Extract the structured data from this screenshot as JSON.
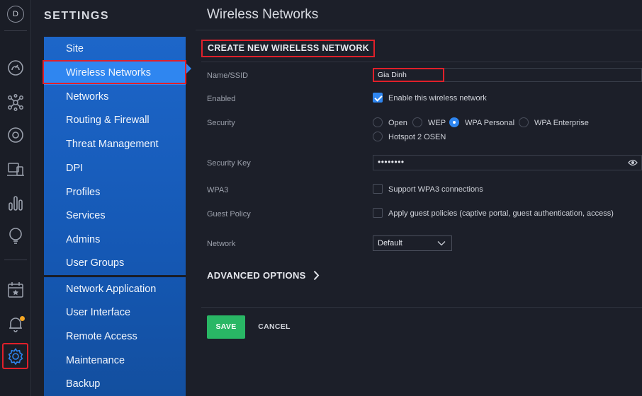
{
  "user": {
    "initial": "D"
  },
  "rail": {
    "icons": [
      "dashboard-icon",
      "topology-icon",
      "devices-icon",
      "clients-icon",
      "statistics-icon",
      "insights-icon",
      "events-icon",
      "alerts-icon",
      "settings-icon"
    ],
    "active": "settings-icon",
    "alert_dot_color": "#f5a623"
  },
  "settings": {
    "title": "SETTINGS",
    "menu": [
      {
        "label": "Site"
      },
      {
        "label": "Wireless Networks",
        "active": true
      },
      {
        "label": "Networks"
      },
      {
        "label": "Routing & Firewall"
      },
      {
        "label": "Threat Management"
      },
      {
        "label": "DPI"
      },
      {
        "label": "Profiles"
      },
      {
        "label": "Services"
      },
      {
        "label": "Admins"
      },
      {
        "label": "User Groups"
      },
      {
        "label": "Network Application"
      },
      {
        "label": "User Interface"
      },
      {
        "label": "Remote Access"
      },
      {
        "label": "Maintenance"
      },
      {
        "label": "Backup"
      }
    ]
  },
  "main": {
    "title": "Wireless Networks",
    "section_title": "CREATE NEW WIRELESS NETWORK",
    "form": {
      "name": {
        "label": "Name/SSID",
        "value": "Gia Dinh"
      },
      "enabled": {
        "label": "Enabled",
        "option": "Enable this wireless network",
        "checked": true
      },
      "security": {
        "label": "Security",
        "options": [
          "Open",
          "WEP",
          "WPA Personal",
          "WPA Enterprise",
          "Hotspot 2 OSEN"
        ],
        "selected": "WPA Personal"
      },
      "security_key": {
        "label": "Security Key",
        "value": "••••••••"
      },
      "wpa3": {
        "label": "WPA3",
        "option": "Support WPA3 connections",
        "checked": false
      },
      "guest_policy": {
        "label": "Guest Policy",
        "option": "Apply guest policies (captive portal, guest authentication, access)",
        "checked": false
      },
      "network": {
        "label": "Network",
        "value": "Default"
      }
    },
    "advanced_label": "ADVANCED OPTIONS",
    "buttons": {
      "save": "SAVE",
      "cancel": "CANCEL"
    }
  },
  "colors": {
    "accent": "#2f86f0",
    "menu_blue": "#1d66c9",
    "save_green": "#29b765",
    "highlight_red": "#e0202a",
    "background": "#1c1f29"
  }
}
